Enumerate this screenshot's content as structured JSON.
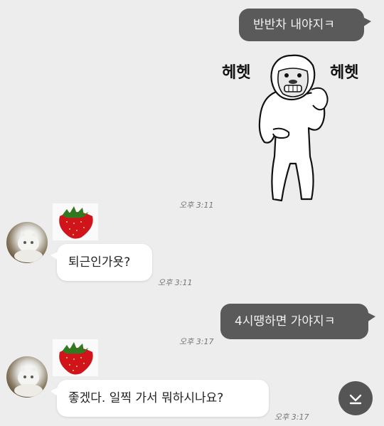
{
  "messages": {
    "m1": {
      "text": "반반차 내야지ㅋ",
      "time": ""
    },
    "sticker": {
      "left_text": "헤헷",
      "right_text": "헤헷",
      "time": "오후 3:11"
    },
    "m2": {
      "text": "퇴근인가욧?",
      "time": "오후 3:11"
    },
    "m3": {
      "text": "4시땡하면 가야지ㅋ",
      "time": "오후 3:17"
    },
    "m4": {
      "text": "좋겠다. 일찍 가서 뭐하시나요?",
      "time": "오후 3:17"
    }
  },
  "icons": {
    "avatar": "cat-avatar",
    "emoji": "strawberry-icon",
    "scroll": "chevron-down-icon"
  },
  "colors": {
    "background": "#ededed",
    "outgoing_bubble": "#5a5a5a",
    "incoming_bubble": "#ffffff"
  }
}
